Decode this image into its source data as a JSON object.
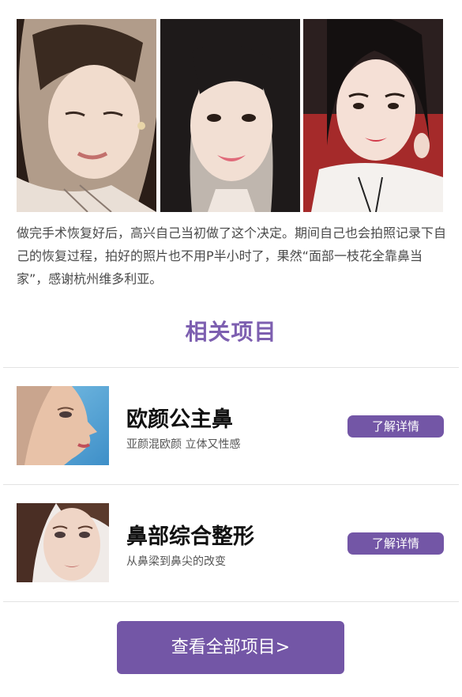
{
  "photos": [
    {
      "icon": "portrait-photo-closed-eyes"
    },
    {
      "icon": "portrait-photo-smiling"
    },
    {
      "icon": "portrait-photo-selfie"
    }
  ],
  "testimonial": {
    "text": "做完手术恢复好后，高兴自己当初做了这个决定。期间自己也会拍照记录下自己的恢复过程，拍好的照片也不用P半小时了，果然“面部一枝花全靠鼻当家”，感谢杭州维多利亚。"
  },
  "related": {
    "title": "相关项目",
    "items": [
      {
        "name": "欧颜公主鼻",
        "desc": "亚颜混欧颜 立体又性感",
        "button": "了解详情",
        "thumb_icon": "profile-face-photo"
      },
      {
        "name": "鼻部综合整形",
        "desc": "从鼻梁到鼻尖的改变",
        "button": "了解详情",
        "thumb_icon": "face-portrait-photo"
      }
    ],
    "view_all": "查看全部项目>"
  },
  "colors": {
    "accent": "#7356a6",
    "title": "#7d5fb0",
    "divider": "#e3e3e3"
  }
}
